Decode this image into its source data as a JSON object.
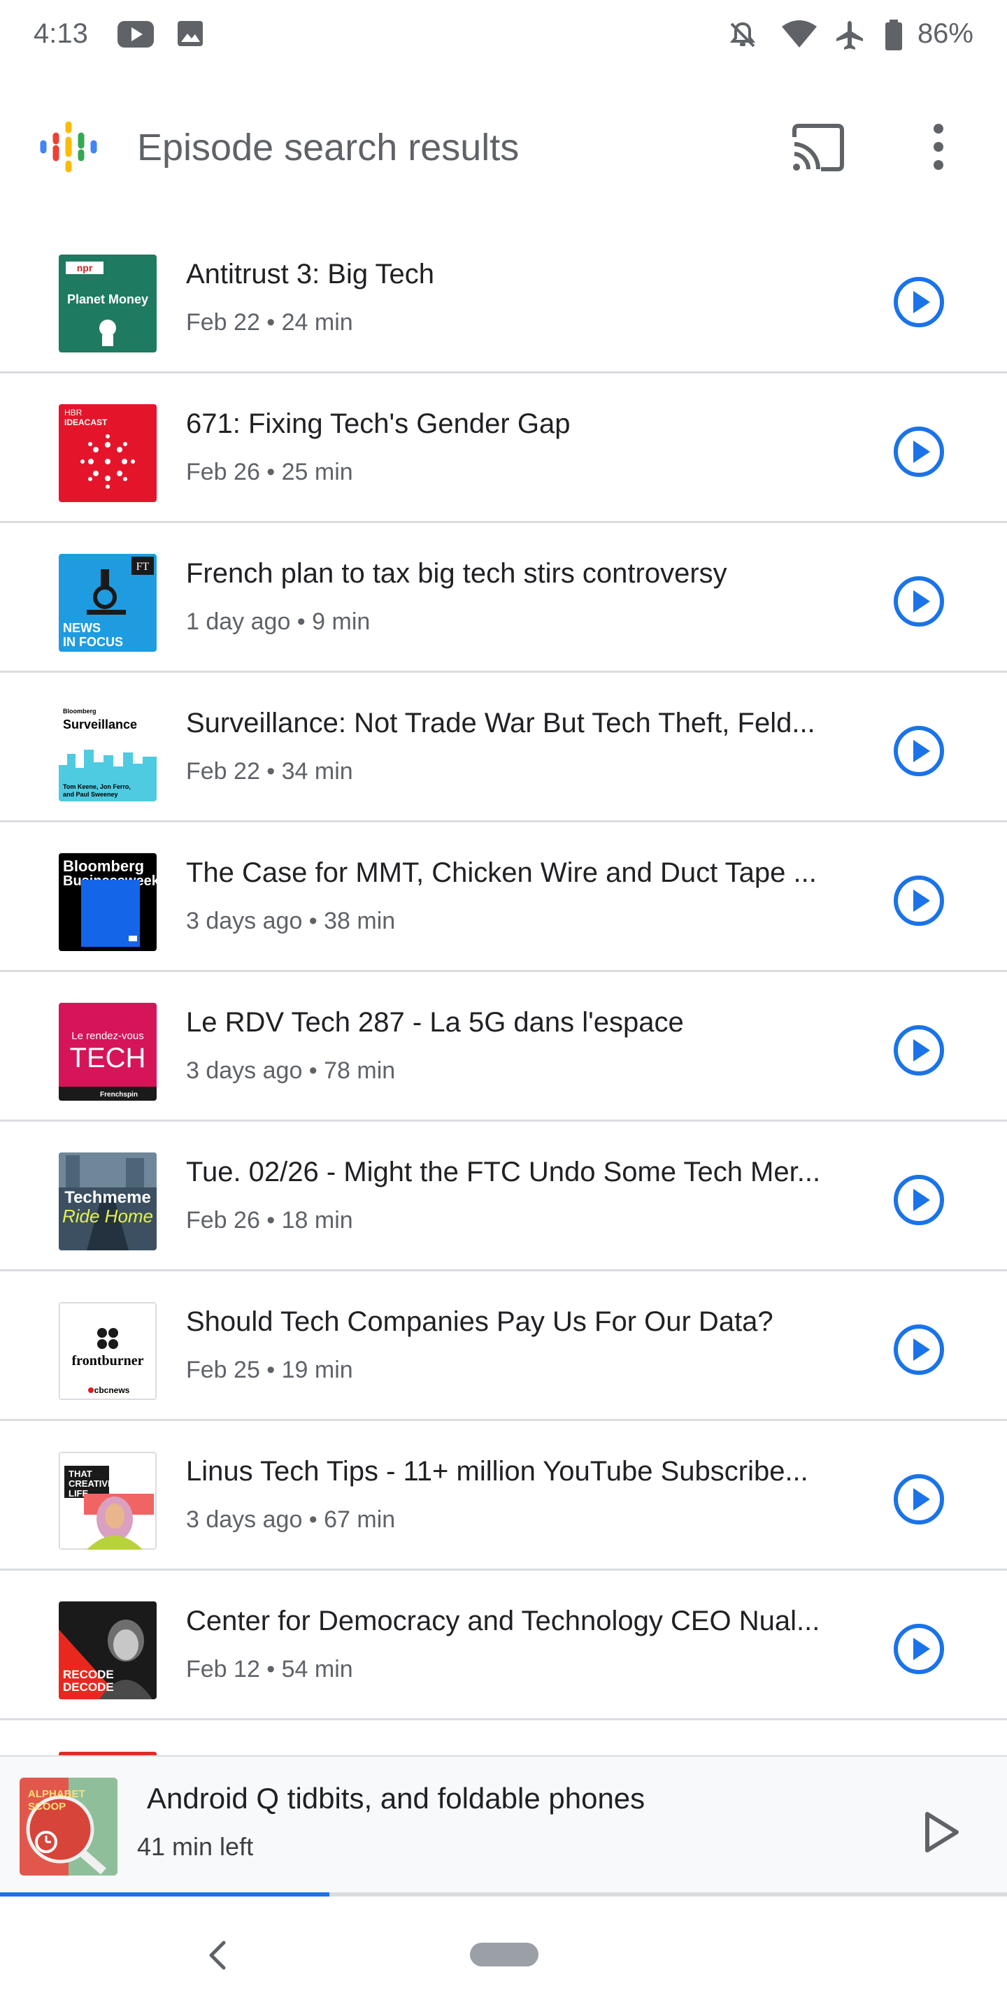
{
  "status_bar": {
    "time": "4:13",
    "battery": "86%",
    "icons": [
      "youtube-icon",
      "image-icon",
      "do-not-disturb-icon",
      "wifi-icon",
      "airplane-mode-icon",
      "battery-icon"
    ]
  },
  "app_bar": {
    "title": "Episode search results",
    "logo_icon": "google-podcasts-logo",
    "cast_icon": "cast-icon",
    "more_icon": "more-vert-icon"
  },
  "episodes": [
    {
      "title": "Antitrust 3: Big Tech",
      "meta": "Feb 22 • 24 min",
      "art_text": [
        "npr",
        "Planet Money"
      ]
    },
    {
      "title": "671: Fixing Tech's Gender Gap",
      "meta": "Feb 26 • 25 min",
      "art_text": [
        "HBR",
        "IDEACAST"
      ]
    },
    {
      "title": "French plan to tax big tech stirs controversy",
      "meta": "1 day ago • 9 min",
      "art_text": [
        "FT",
        "NEWS",
        "IN FOCUS"
      ]
    },
    {
      "title": "Surveillance: Not Trade War But Tech Theft, Feld...",
      "meta": "Feb 22 • 34 min",
      "art_text": [
        "Bloomberg",
        "Surveillance",
        "Tom Keene, Jon Ferro,",
        "and Paul Sweeney"
      ]
    },
    {
      "title": "The Case for MMT, Chicken Wire and Duct Tape ...",
      "meta": "3 days ago • 38 min",
      "art_text": [
        "Bloomberg",
        "Businessweek"
      ]
    },
    {
      "title": "Le RDV Tech 287 - La 5G dans l'espace",
      "meta": "3 days ago • 78 min",
      "art_text": [
        "Le rendez-vous",
        "TECH",
        "Frenchspin"
      ]
    },
    {
      "title": "Tue. 02/26 - Might the FTC Undo Some Tech Mer...",
      "meta": "Feb 26 • 18 min",
      "art_text": [
        "Techmeme",
        "Ride Home"
      ]
    },
    {
      "title": "Should Tech Companies Pay Us For Our Data?",
      "meta": "Feb 25 • 19 min",
      "art_text": [
        "frontburner",
        "cbcnews"
      ]
    },
    {
      "title": "Linus Tech Tips - 11+ million YouTube Subscribe...",
      "meta": "3 days ago • 67 min",
      "art_text": [
        "THAT",
        "CREATIVE",
        "LIFE"
      ]
    },
    {
      "title": "Center for Democracy and Technology CEO Nual...",
      "meta": "Feb 12 • 54 min",
      "art_text": [
        "RECODE",
        "DECODE"
      ]
    }
  ],
  "now_playing": {
    "title": "Android Q tidbits, and foldable phones",
    "time_left": "41 min left",
    "art_text": [
      "ALPHABET",
      "SCOOP"
    ],
    "progress": 0.327
  },
  "colors": {
    "accent": "#1a73e8",
    "text_primary": "#202124",
    "text_secondary": "#5f6368",
    "divider": "#dadce0"
  }
}
